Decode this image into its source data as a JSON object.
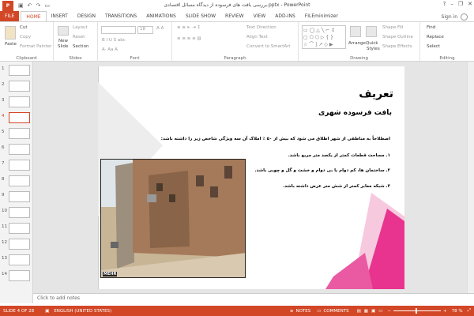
{
  "window": {
    "title": "بررسی بافت های فرسوده از دیدگاه مسائل اقتصادی.pptx - PowerPoint",
    "logo": "P",
    "controls": [
      "?",
      "–",
      "❐",
      "✕"
    ],
    "sign_in": "Sign in"
  },
  "quick_access": {
    "save": "save-icon",
    "undo": "undo-icon",
    "redo": "redo-icon",
    "present": "present-icon"
  },
  "tabs": [
    "FILE",
    "HOME",
    "INSERT",
    "DESIGN",
    "TRANSITIONS",
    "ANIMATIONS",
    "SLIDE SHOW",
    "REVIEW",
    "VIEW",
    "ADD-INS",
    "FILEminimizer"
  ],
  "active_tab": "HOME",
  "ribbon": {
    "clipboard": {
      "label": "Clipboard",
      "paste": "Paste",
      "cut": "Cut",
      "copy": "Copy",
      "format_painter": "Format Painter"
    },
    "slides": {
      "label": "Slides",
      "new_slide": "New",
      "new_slide2": "Slide",
      "layout": "Layout",
      "reset": "Reset",
      "section": "Section"
    },
    "font": {
      "label": "Font",
      "size": "18"
    },
    "paragraph": {
      "label": "Paragraph",
      "text_direction": "Text Direction",
      "align_text": "Align Text",
      "smartart": "Convert to SmartArt"
    },
    "drawing": {
      "label": "Drawing",
      "arrange": "Arrange",
      "quick_styles": "Quick",
      "quick_styles2": "Styles",
      "shape_fill": "Shape Fill",
      "shape_outline": "Shape Outline",
      "shape_effects": "Shape Effects"
    },
    "editing": {
      "label": "Editing",
      "find": "Find",
      "replace": "Replace",
      "select": "Select"
    }
  },
  "thumbnails": [
    "1",
    "2",
    "3",
    "4",
    "5",
    "6",
    "7",
    "8",
    "9",
    "10",
    "11",
    "12",
    "13",
    "14"
  ],
  "selected_thumbnail": "4",
  "slide": {
    "title": "تعریف",
    "subtitle": "بافت فرسوده شهری",
    "intro": "اصطلاحاً به مناطقی از شهر اطلاق می شود که بیش از ۵۰ ٪ املاک آن سه ویژگی شاخص زیر را داشته باشد:",
    "bullets": [
      "۱. مساحت قطعات کمتر از یکصد متر مربع باشد.",
      "۲. ساختمان ها، کم دوام یا بی دوام و خشت و گل و چوبی باشد.",
      "۳. شبکه معابر کمتر از شش متر عرض داشته باشد."
    ],
    "photo_watermark": "MEHR",
    "accent_color": "#e8348f"
  },
  "notes_placeholder": "Click to add notes",
  "status": {
    "slide": "SLIDE 4 OF 28",
    "language": "ENGLISH (UNITED STATES)",
    "notes": "NOTES",
    "comments": "COMMENTS",
    "zoom": "78 %"
  }
}
